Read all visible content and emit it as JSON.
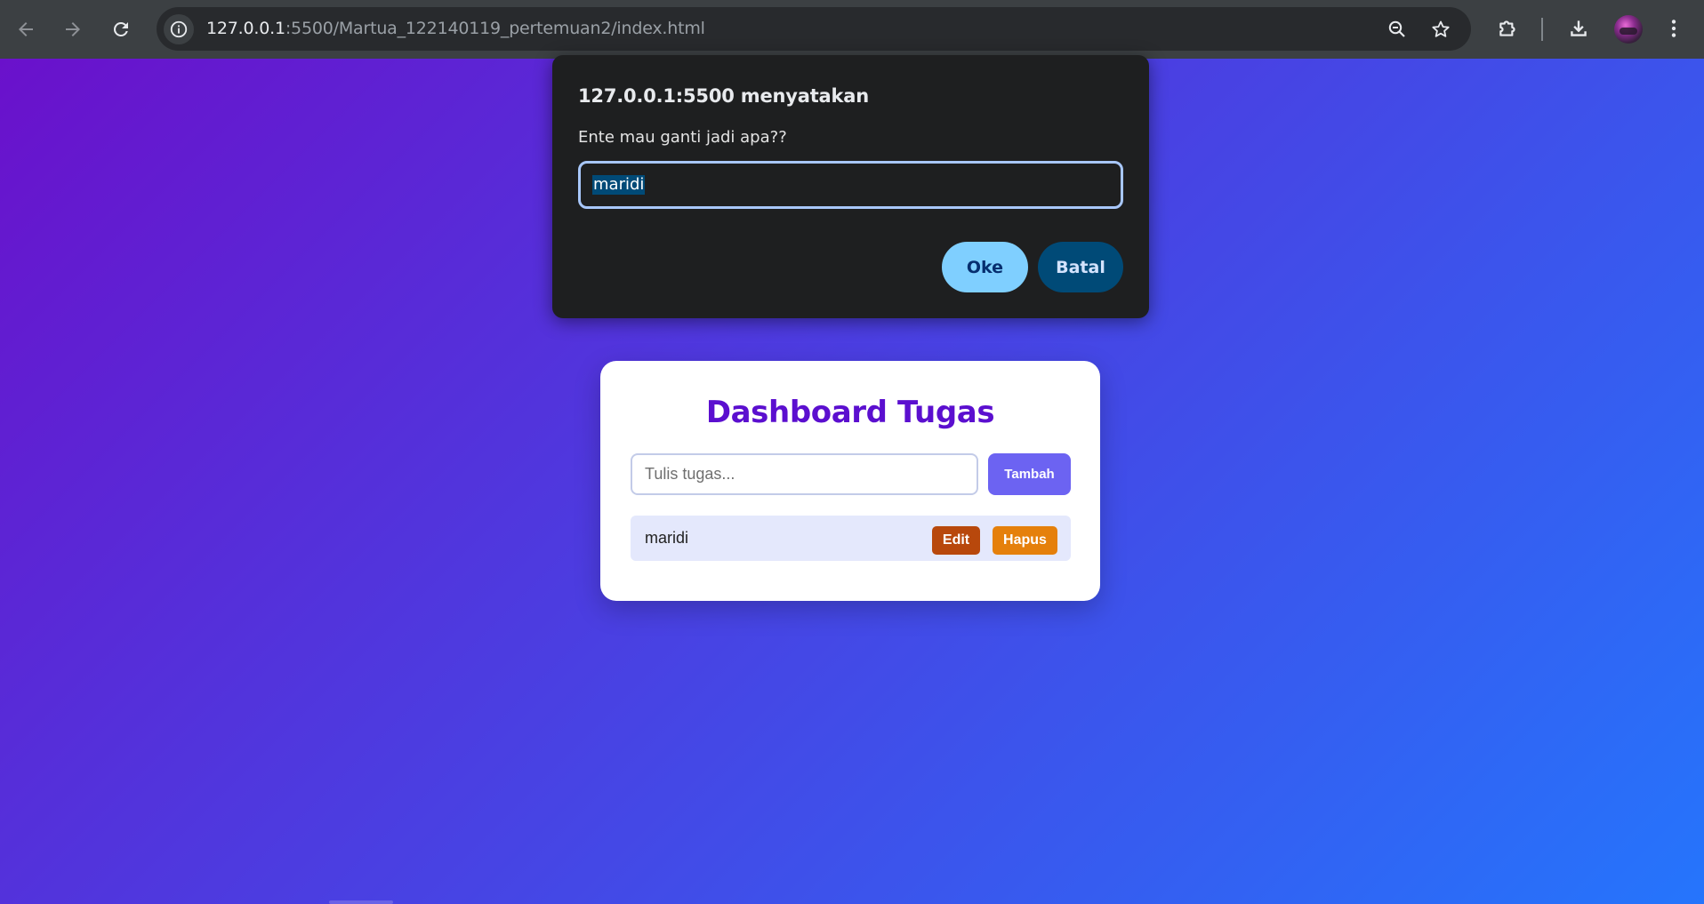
{
  "browser": {
    "url_host": "127.0.0.1",
    "url_path": ":5500/Martua_122140119_pertemuan2/index.html",
    "icons": {
      "back": "arrow-left-icon",
      "forward": "arrow-right-icon",
      "reload": "reload-icon",
      "site_info": "info-icon",
      "zoom": "zoom-out-icon",
      "bookmark": "star-icon",
      "extensions": "puzzle-icon",
      "downloads": "download-icon",
      "menu": "kebab-menu-icon"
    }
  },
  "dialog": {
    "title": "127.0.0.1:5500 menyatakan",
    "message": "Ente mau ganti jadi apa??",
    "input_value": "maridi",
    "ok_label": "Oke",
    "cancel_label": "Batal"
  },
  "dashboard": {
    "title": "Dashboard Tugas",
    "input_placeholder": "Tulis tugas...",
    "input_value": "",
    "add_label": "Tambah",
    "tasks": [
      {
        "text": "maridi",
        "edit_label": "Edit",
        "delete_label": "Hapus"
      }
    ]
  },
  "colors": {
    "gradient_start": "#6a11cb",
    "gradient_end": "#2575fc",
    "title": "#5b0fcf",
    "add_button": "#6c63f2",
    "edit_button": "#b8480c",
    "delete_button": "#e5800b",
    "dialog_bg": "#1e1f20",
    "ok_button": "#7fcfff",
    "cancel_button": "#004a77"
  }
}
